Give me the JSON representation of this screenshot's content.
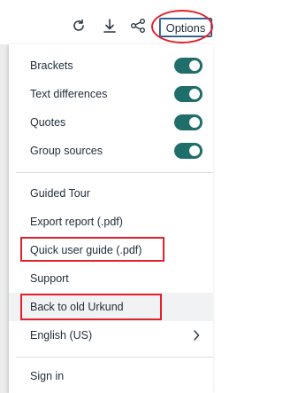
{
  "toolbar": {
    "options_label": "Options",
    "icons": [
      "refresh-icon",
      "download-icon",
      "share-icon"
    ]
  },
  "menu": {
    "toggles": [
      {
        "label": "Brackets",
        "on": true
      },
      {
        "label": "Text differences",
        "on": true
      },
      {
        "label": "Quotes",
        "on": true
      },
      {
        "label": "Group sources",
        "on": true
      }
    ],
    "items": [
      {
        "label": "Guided Tour"
      },
      {
        "label": "Export report (.pdf)"
      },
      {
        "label": "Quick user guide (.pdf)",
        "highlighted_box": true
      },
      {
        "label": "Support"
      },
      {
        "label": "Back to old Urkund",
        "highlighted_box": true,
        "hover": true
      }
    ],
    "language": {
      "label": "English (US)"
    },
    "sign_in": {
      "label": "Sign in"
    }
  },
  "colors": {
    "toggle_on": "#1f6e6a",
    "annotation_red": "#e1212b",
    "text": "#1f2d3a"
  }
}
